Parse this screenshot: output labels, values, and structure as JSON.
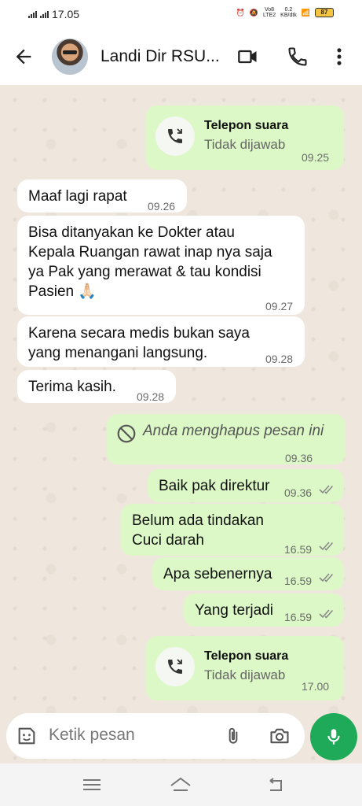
{
  "status_bar": {
    "time": "17.05",
    "net_top": "Vo8",
    "net_mid": "LTE2",
    "speed_top": "0.2",
    "speed_bot": "KB/dtk",
    "battery": "87"
  },
  "header": {
    "contact_name": "Landi Dir RSU..."
  },
  "messages": {
    "call1": {
      "title": "Telepon suara",
      "status": "Tidak dijawab",
      "time": "09.25"
    },
    "m1": {
      "text": "Maaf lagi rapat",
      "time": "09.26"
    },
    "m2": {
      "line1": "Bisa ditanyakan ke Dokter atau",
      "line2": "Kepala Ruangan rawat inap nya saja",
      "line3": "ya Pak yang merawat & tau kondisi",
      "line4": "Pasien 🙏🏻",
      "time": "09.27"
    },
    "m3": {
      "line1": "Karena secara medis bukan saya",
      "line2": "yang menangani langsung.",
      "time": "09.28"
    },
    "m4": {
      "text": "Terima kasih.",
      "time": "09.28"
    },
    "deleted": {
      "text": "Anda menghapus pesan ini",
      "time": "09.36"
    },
    "o1": {
      "text": "Baik pak direktur",
      "time": "09.36"
    },
    "o2": {
      "line1": "Belum ada tindakan",
      "line2": "Cuci darah",
      "time": "16.59"
    },
    "o3": {
      "text": "Apa sebenernya",
      "time": "16.59"
    },
    "o4": {
      "text": "Yang terjadi",
      "time": "16.59"
    },
    "call2": {
      "title": "Telepon suara",
      "status": "Tidak dijawab",
      "time": "17.00"
    }
  },
  "input": {
    "placeholder": "Ketik pesan"
  },
  "colors": {
    "outgoing": "#dcf8c6",
    "incoming": "#ffffff",
    "accent": "#1faa59",
    "read_ticks": "#8a8a8a"
  },
  "icons": [
    "back-arrow-icon",
    "video-call-icon",
    "phone-icon",
    "more-vert-icon",
    "missed-call-icon",
    "blocked-icon",
    "double-check-icon",
    "sticker-icon",
    "attach-icon",
    "camera-icon",
    "mic-icon",
    "menu-icon",
    "home-icon",
    "back-icon"
  ]
}
